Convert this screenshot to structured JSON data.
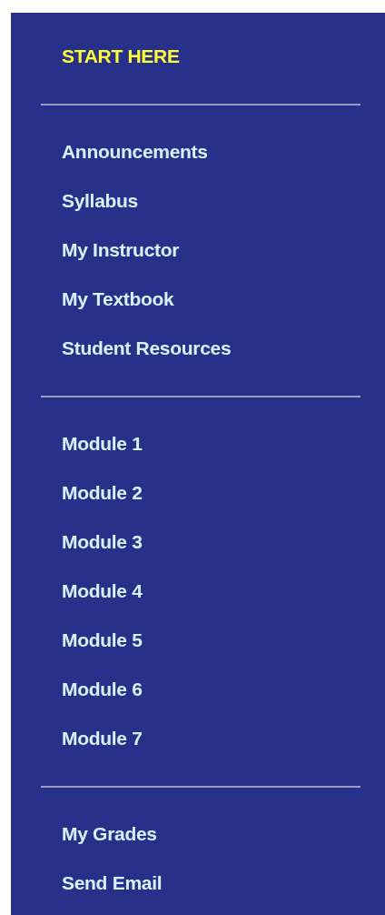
{
  "header": {
    "label": "START HERE"
  },
  "sections": [
    {
      "items": [
        "Announcements",
        "Syllabus",
        "My Instructor",
        "My Textbook",
        "Student Resources"
      ]
    },
    {
      "items": [
        "Module 1",
        "Module 2",
        "Module 3",
        "Module 4",
        "Module 5",
        "Module 6",
        "Module 7"
      ]
    },
    {
      "items": [
        "My Grades",
        "Send Email"
      ]
    }
  ]
}
